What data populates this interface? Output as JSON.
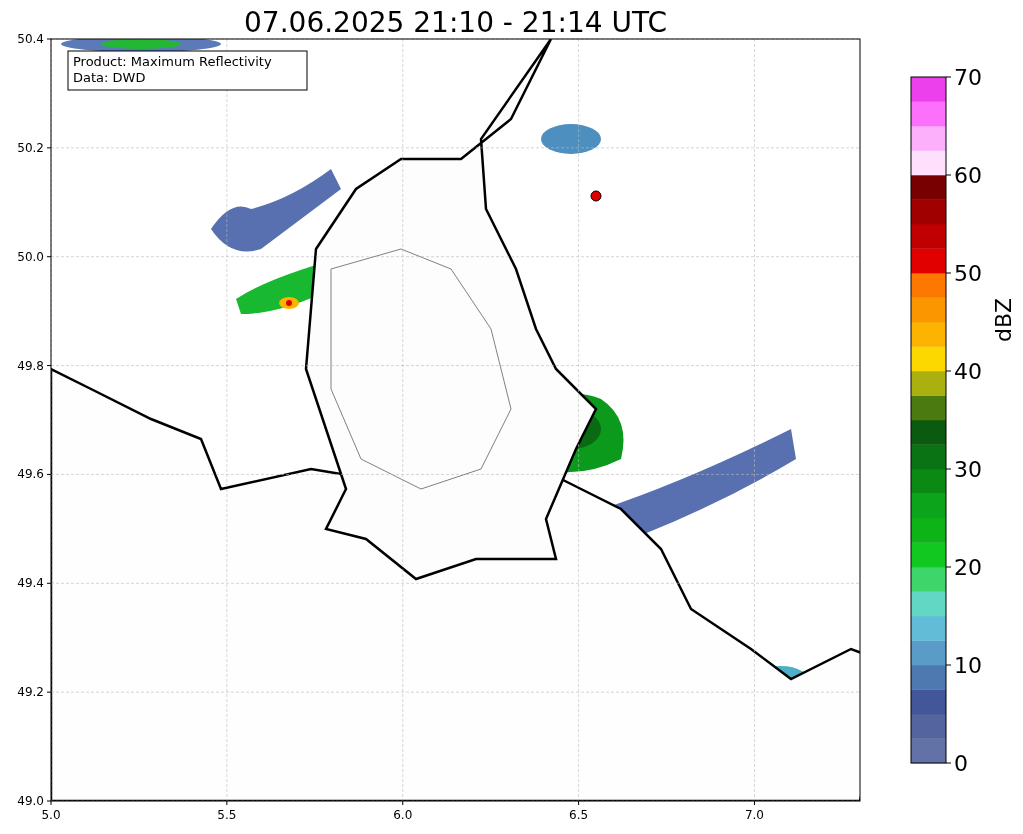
{
  "title": "07.06.2025 21:10 - 21:14 UTC",
  "info_box": [
    "Product: Maximum Reflectivity",
    "Data: DWD"
  ],
  "map": {
    "xticks": [
      "5.0",
      "5.5",
      "6.0",
      "6.5",
      "7.0"
    ],
    "yticks": [
      "50.4",
      "50.2",
      "50.0",
      "49.8",
      "49.6",
      "49.4",
      "49.2",
      "49.0"
    ]
  },
  "colorbar": {
    "label": "dBZ",
    "ticks": [
      "70",
      "60",
      "50",
      "40",
      "30",
      "20",
      "10",
      "0"
    ],
    "bands": [
      {
        "color": "#6272a6"
      },
      {
        "color": "#53649e"
      },
      {
        "color": "#43569a"
      },
      {
        "color": "#4d78b0"
      },
      {
        "color": "#5a9bc8"
      },
      {
        "color": "#62bcd8"
      },
      {
        "color": "#62d8c4"
      },
      {
        "color": "#3dd66a"
      },
      {
        "color": "#10c820"
      },
      {
        "color": "#0db418"
      },
      {
        "color": "#0ca41a"
      },
      {
        "color": "#0a8a12"
      },
      {
        "color": "#0a7414"
      },
      {
        "color": "#0a5a10"
      },
      {
        "color": "#4a7a10"
      },
      {
        "color": "#aab010"
      },
      {
        "color": "#fdd800"
      },
      {
        "color": "#fcb400"
      },
      {
        "color": "#fc9600"
      },
      {
        "color": "#fc7800"
      },
      {
        "color": "#e00000"
      },
      {
        "color": "#c00000"
      },
      {
        "color": "#a00000"
      },
      {
        "color": "#780000"
      },
      {
        "color": "#ffe0fc"
      },
      {
        "color": "#fcb0fc"
      },
      {
        "color": "#fc70fc"
      },
      {
        "color": "#ec40ec"
      }
    ]
  }
}
